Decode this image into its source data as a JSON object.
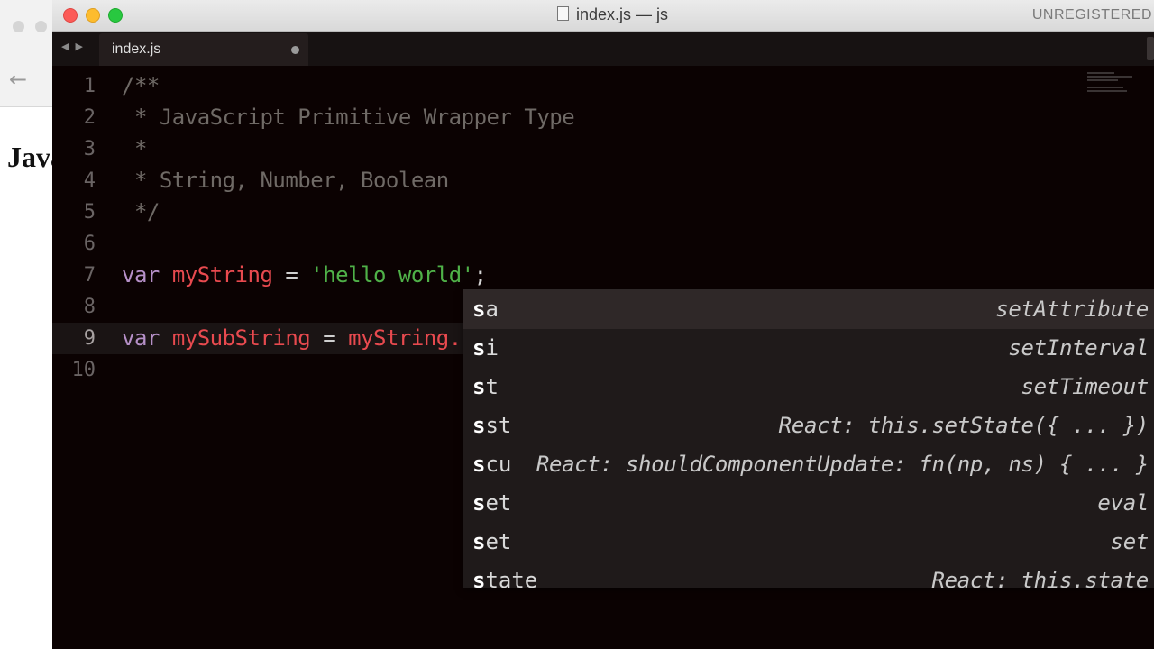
{
  "background_window": {
    "heading": "Java",
    "back_icon": "arrow-left-icon"
  },
  "window": {
    "title": "index.js — js",
    "unregistered": "UNREGISTERED",
    "traffic_colors": {
      "close": "#fc5b57",
      "minimize": "#fdbc2e",
      "maximize": "#28c840"
    }
  },
  "tabs": [
    {
      "label": "index.js",
      "dirty": true
    }
  ],
  "editor": {
    "current_line": 9,
    "lines": [
      {
        "number": "1",
        "tokens": [
          {
            "t": "/**",
            "c": "comment"
          }
        ]
      },
      {
        "number": "2",
        "tokens": [
          {
            "t": " * JavaScript Primitive Wrapper Type",
            "c": "comment"
          }
        ]
      },
      {
        "number": "3",
        "tokens": [
          {
            "t": " *",
            "c": "comment"
          }
        ]
      },
      {
        "number": "4",
        "tokens": [
          {
            "t": " * String, Number, Boolean",
            "c": "comment"
          }
        ]
      },
      {
        "number": "5",
        "tokens": [
          {
            "t": " */",
            "c": "comment"
          }
        ]
      },
      {
        "number": "6",
        "tokens": []
      },
      {
        "number": "7",
        "tokens": [
          {
            "t": "var",
            "c": "keyword"
          },
          {
            "t": " ",
            "c": "plain"
          },
          {
            "t": "myString",
            "c": "variable"
          },
          {
            "t": " = ",
            "c": "operator"
          },
          {
            "t": "'hello world'",
            "c": "string"
          },
          {
            "t": ";",
            "c": "plain"
          }
        ]
      },
      {
        "number": "8",
        "tokens": []
      },
      {
        "number": "9",
        "tokens": [
          {
            "t": "var",
            "c": "keyword"
          },
          {
            "t": " ",
            "c": "plain"
          },
          {
            "t": "mySubString",
            "c": "variable"
          },
          {
            "t": " = ",
            "c": "operator"
          },
          {
            "t": "myString.s",
            "c": "variable"
          }
        ]
      },
      {
        "number": "10",
        "tokens": []
      }
    ],
    "colors": {
      "comment": "#6f6a66",
      "keyword": "#b690c8",
      "variable": "#e84a4f",
      "string": "#4fb148",
      "background": "#0b0202"
    }
  },
  "autocomplete": {
    "selected_index": 0,
    "items": [
      {
        "match": "s",
        "rest": "a",
        "description": "setAttribute"
      },
      {
        "match": "s",
        "rest": "i",
        "description": "setInterval"
      },
      {
        "match": "s",
        "rest": "t",
        "description": "setTimeout"
      },
      {
        "match": "s",
        "rest": "st",
        "description": "React: this.setState({ ... })"
      },
      {
        "match": "s",
        "rest": "cu",
        "description": "React: shouldComponentUpdate: fn(np, ns) { ... }"
      },
      {
        "match": "s",
        "rest": "et",
        "description": "eval"
      },
      {
        "match": "s",
        "rest": "et",
        "description": "set"
      },
      {
        "match": "s",
        "rest": "tate",
        "description": "React: this.state"
      }
    ]
  }
}
